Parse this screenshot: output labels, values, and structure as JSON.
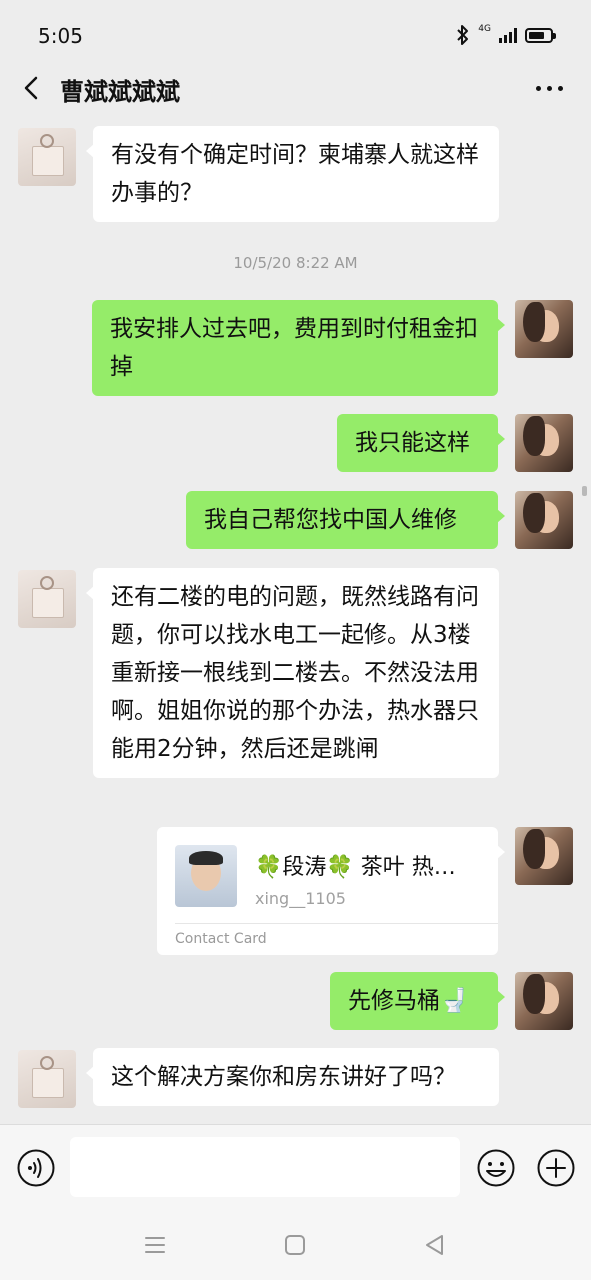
{
  "status_bar": {
    "time": "5:05",
    "network": "4G"
  },
  "header": {
    "title": "曹斌斌斌斌"
  },
  "messages": [
    {
      "side": "left",
      "type": "text",
      "text": "有没有个确定时间？柬埔寨人就这样办事的？"
    },
    {
      "type": "timestamp",
      "text": "10/5/20 8:22 AM"
    },
    {
      "side": "right",
      "type": "text",
      "text": "我安排人过去吧，费用到时付租金扣掉"
    },
    {
      "side": "right",
      "type": "text",
      "text": "我只能这样"
    },
    {
      "side": "right",
      "type": "text",
      "text": "我自己帮您找中国人维修"
    },
    {
      "side": "left",
      "type": "text",
      "text": "还有二楼的电的问题，既然线路有问题，你可以找水电工一起修。从3楼重新接一根线到二楼去。不然没法用啊。姐姐你说的那个办法，热水器只能用2分钟，然后还是跳闸"
    },
    {
      "side": "right",
      "type": "contact_card",
      "name": "🍀段涛🍀 茶叶 热…",
      "id": "xing__1105",
      "label": "Contact Card"
    },
    {
      "side": "right",
      "type": "text",
      "text": "先修马桶🚽"
    },
    {
      "side": "left",
      "type": "text",
      "text": "这个解决方案你和房东讲好了吗？"
    }
  ],
  "input_bar": {
    "value": "",
    "placeholder": ""
  },
  "icons": {
    "back": "chevron-left-icon",
    "more": "more-dots-icon",
    "voice": "voice-icon",
    "emoji": "emoji-icon",
    "plus": "plus-icon"
  },
  "colors": {
    "background": "#ededed",
    "sent_bubble": "#95ec69",
    "received_bubble": "#ffffff"
  }
}
